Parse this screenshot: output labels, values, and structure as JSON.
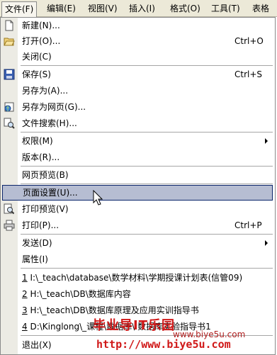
{
  "menubar": {
    "items": [
      {
        "label": "文件(F)"
      },
      {
        "label": "编辑(E)"
      },
      {
        "label": "视图(V)"
      },
      {
        "label": "插入(I)"
      },
      {
        "label": "格式(O)"
      },
      {
        "label": "工具(T)"
      },
      {
        "label": "表格"
      }
    ]
  },
  "menu": {
    "new": {
      "label": "新建(N)...",
      "icon": "new-document-icon"
    },
    "open": {
      "label": "打开(O)...",
      "shortcut": "Ctrl+O",
      "icon": "open-folder-icon"
    },
    "close": {
      "label": "关闭(C)"
    },
    "save": {
      "label": "保存(S)",
      "shortcut": "Ctrl+S",
      "icon": "save-disk-icon"
    },
    "save_as": {
      "label": "另存为(A)..."
    },
    "save_as_web": {
      "label": "另存为网页(G)...",
      "icon": "web-page-icon"
    },
    "file_search": {
      "label": "文件搜索(H)...",
      "icon": "file-search-icon"
    },
    "permission": {
      "label": "权限(M)"
    },
    "version": {
      "label": "版本(R)..."
    },
    "web_preview": {
      "label": "网页预览(B)"
    },
    "page_setup": {
      "label": "页面设置(U)..."
    },
    "print_preview": {
      "label": "打印预览(V)",
      "icon": "print-preview-icon"
    },
    "print": {
      "label": "打印(P)...",
      "shortcut": "Ctrl+P",
      "icon": "printer-icon"
    },
    "send_to": {
      "label": "发送(D)"
    },
    "properties": {
      "label": "属性(I)"
    },
    "recent": [
      {
        "num": "1",
        "path": "I:\\_teach\\database\\数学材料\\学期授课计划表(信管09)"
      },
      {
        "num": "2",
        "path": "H:\\_teach\\DB\\数据库内容"
      },
      {
        "num": "3",
        "path": "H:\\_teach\\DB\\数据库原理及应用实训指导书"
      },
      {
        "num": "4",
        "path": "D:\\Kinglong\\_课程\\数据库\\  数据库实验指导书1"
      }
    ],
    "exit": {
      "label": "退出(X)"
    }
  },
  "watermark": {
    "title": "毕业导IT乐园",
    "url_small": "www.biye5u.com",
    "url_big": "http://www.biye5u.com"
  }
}
